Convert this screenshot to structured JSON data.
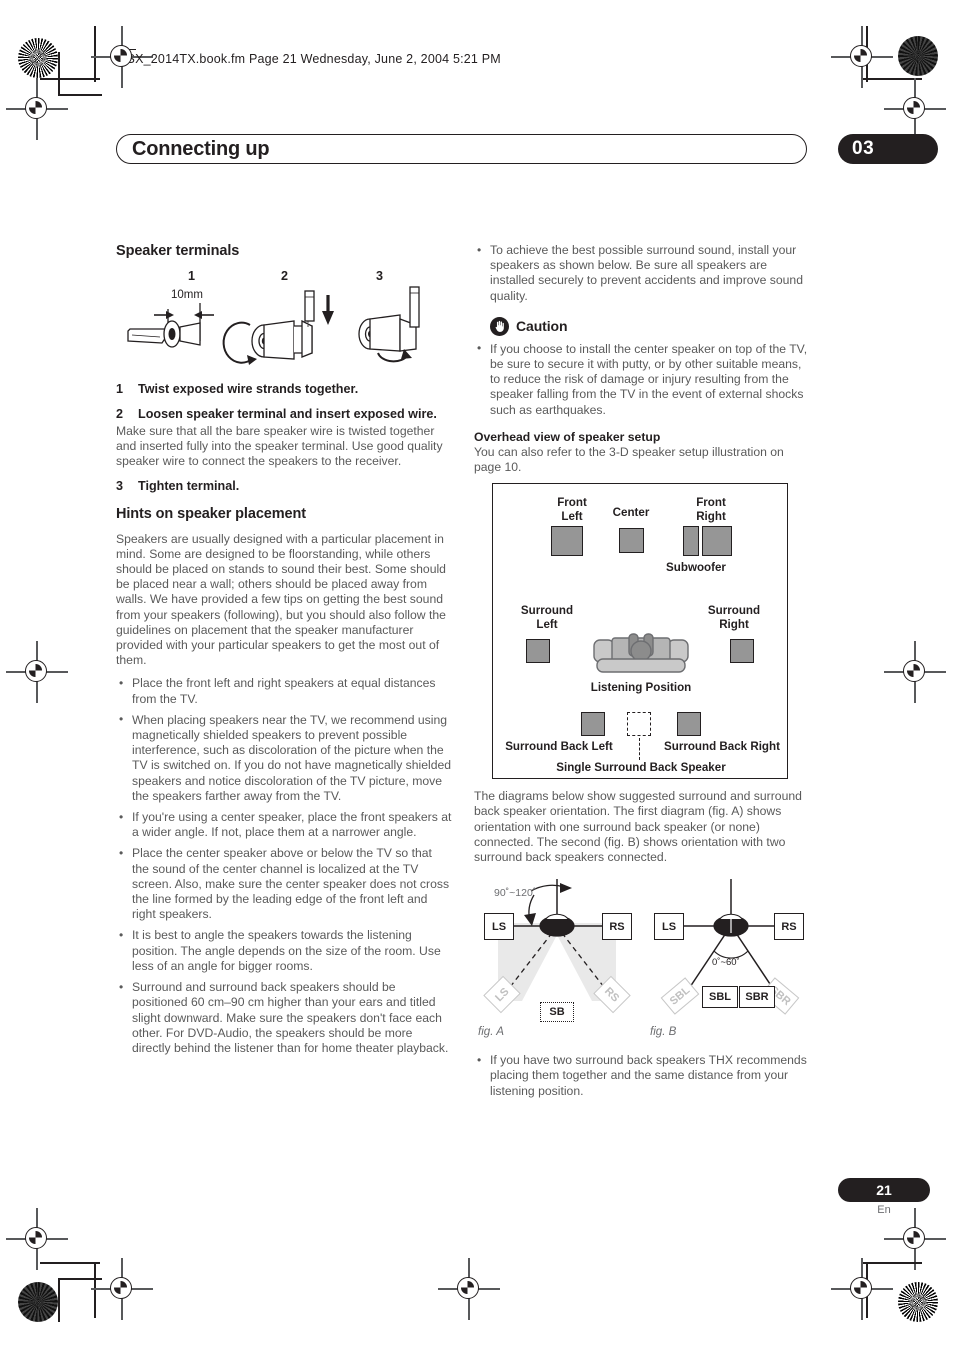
{
  "header": {
    "filename_line": "VSX_2014TX.book.fm  Page 21  Wednesday, June 2, 2004  5:21 PM",
    "chapter_title": "Connecting up",
    "chapter_number": "03"
  },
  "footer": {
    "page_number": "21",
    "language_code": "En"
  },
  "left_column": {
    "section_title": "Speaker terminals",
    "figure": {
      "step_labels": [
        "1",
        "2",
        "3"
      ],
      "dimension_label": "10mm"
    },
    "steps": [
      {
        "number": "1",
        "text": "Twist exposed wire strands together."
      },
      {
        "number": "2",
        "text": "Loosen speaker terminal and insert exposed wire."
      },
      {
        "number": "3",
        "text": "Tighten terminal."
      }
    ],
    "step2_body": "Make sure that all the bare speaker wire is twisted together and inserted fully into the speaker terminal. Use good quality speaker wire to connect the speakers to the receiver.",
    "hints_title": "Hints on speaker placement",
    "hints_intro": "Speakers are usually designed with a particular placement in mind. Some are designed to be floorstanding, while others should be placed on stands to sound their best. Some should be placed near a wall; others should be placed away from walls. We have provided a few tips on getting the best sound from your speakers (following), but you should also follow the guidelines on placement that the speaker manufacturer provided with your particular speakers to get the most out of them.",
    "hints_bullets": [
      "Place the front left and right speakers at equal distances from the TV.",
      "When placing speakers near the TV, we recommend using magnetically shielded speakers to prevent possible interference, such as discoloration of the picture when the TV is switched on. If you do not have magnetically shielded speakers and notice discoloration of the TV picture, move the speakers farther away from the TV.",
      "If you're using a center speaker, place the front speakers at a wider angle. If not, place them at a narrower angle.",
      "Place the center speaker above or below the TV so that the sound of the center channel is localized at the TV screen. Also, make sure the center speaker does not cross the line formed by the leading edge of the front left and right speakers.",
      "It is best to angle the speakers towards the listening position. The angle depends on the size of the room. Use less of an angle for bigger rooms.",
      "Surround and surround back speakers should be positioned 60 cm–90 cm higher than your ears and titled slight downward. Make sure the speakers don't face each other. For DVD-Audio, the speakers should be more directly behind the listener than for home theater playback."
    ]
  },
  "right_column": {
    "top_bullets": [
      "To achieve the best possible surround sound, install your speakers as shown below. Be sure all speakers are installed securely to prevent accidents and improve sound quality."
    ],
    "caution": {
      "icon": "stop-hand-icon",
      "label": "Caution",
      "bullets": [
        "If you choose to install the center speaker on top of the TV, be sure to secure it with putty, or by other suitable means, to reduce the risk of damage or injury resulting from the speaker falling from the TV in the event of external shocks such as earthquakes."
      ]
    },
    "overhead_title": "Overhead view of speaker setup",
    "overhead_intro": "You can also refer to the 3-D speaker setup illustration on page 10.",
    "overhead_diagram": {
      "labels": {
        "front_left": "Front\nLeft",
        "center": "Center",
        "front_right": "Front\nRight",
        "subwoofer": "Subwoofer",
        "surround_left": "Surround\nLeft",
        "surround_right": "Surround\nRight",
        "listening_position": "Listening Position",
        "surround_back_left": "Surround Back Left",
        "surround_back_right": "Surround Back Right",
        "single_surround_back": "Single Surround Back Speaker"
      },
      "speaker_color": "#969696"
    },
    "diagrams_intro": "The diagrams below show suggested surround and surround back speaker orientation. The first diagram (fig. A) shows orientation with one surround back speaker (or none) connected. The second (fig. B) shows orientation with two surround back speakers connected.",
    "fig_a": {
      "caption": "fig. A",
      "angle": "90˚~120˚",
      "boxes": {
        "ls": "LS",
        "rs": "RS",
        "ls_ghost": "LS",
        "rs_ghost": "RS",
        "sb": "SB"
      }
    },
    "fig_b": {
      "caption": "fig. B",
      "angle": "0˚~60˚",
      "boxes": {
        "ls": "LS",
        "rs": "RS",
        "sbl_ghost": "SBL",
        "sbr_ghost": "SBR",
        "sbl": "SBL",
        "sbr": "SBR"
      }
    },
    "bottom_bullets": [
      "If you have two surround back speakers THX recommends placing them together and the same distance from your listening position."
    ]
  }
}
